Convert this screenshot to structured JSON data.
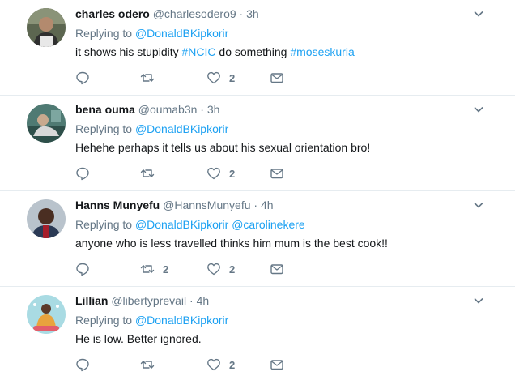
{
  "tweets": [
    {
      "name": "charles odero",
      "handle": "@charlesodero9",
      "time": "3h",
      "reply_prefix": "Replying to",
      "reply_to": [
        "@DonaldBKipkorir"
      ],
      "text_parts": [
        {
          "t": "it shows his stupidity ",
          "link": false
        },
        {
          "t": "#NCIC",
          "link": true
        },
        {
          "t": " do something ",
          "link": false
        },
        {
          "t": "#moseskuria",
          "link": true
        }
      ],
      "reply_count": "",
      "retweet_count": "",
      "like_count": "2"
    },
    {
      "name": "bena ouma",
      "handle": "@oumab3n",
      "time": "3h",
      "reply_prefix": "Replying to",
      "reply_to": [
        "@DonaldBKipkorir"
      ],
      "text_parts": [
        {
          "t": "Hehehe perhaps it tells us about his sexual orientation bro!",
          "link": false
        }
      ],
      "reply_count": "",
      "retweet_count": "",
      "like_count": "2"
    },
    {
      "name": "Hanns Munyefu",
      "handle": "@HannsMunyefu",
      "time": "4h",
      "reply_prefix": "Replying to",
      "reply_to": [
        "@DonaldBKipkorir",
        "@carolinekere"
      ],
      "text_parts": [
        {
          "t": "anyone who is less travelled thinks him mum is the best cook!!",
          "link": false
        }
      ],
      "reply_count": "",
      "retweet_count": "2",
      "like_count": "2"
    },
    {
      "name": "Lillian",
      "handle": "@libertyprevail",
      "time": "4h",
      "reply_prefix": "Replying to",
      "reply_to": [
        "@DonaldBKipkorir"
      ],
      "text_parts": [
        {
          "t": "He is low. Better ignored.",
          "link": false
        }
      ],
      "reply_count": "",
      "retweet_count": "",
      "like_count": "2"
    }
  ],
  "colors": {
    "link": "#1da1f2",
    "secondary": "#657786",
    "divider": "#e6ecf0"
  },
  "icons": [
    "reply-icon",
    "retweet-icon",
    "like-icon",
    "message-icon",
    "chevron-down-icon"
  ]
}
